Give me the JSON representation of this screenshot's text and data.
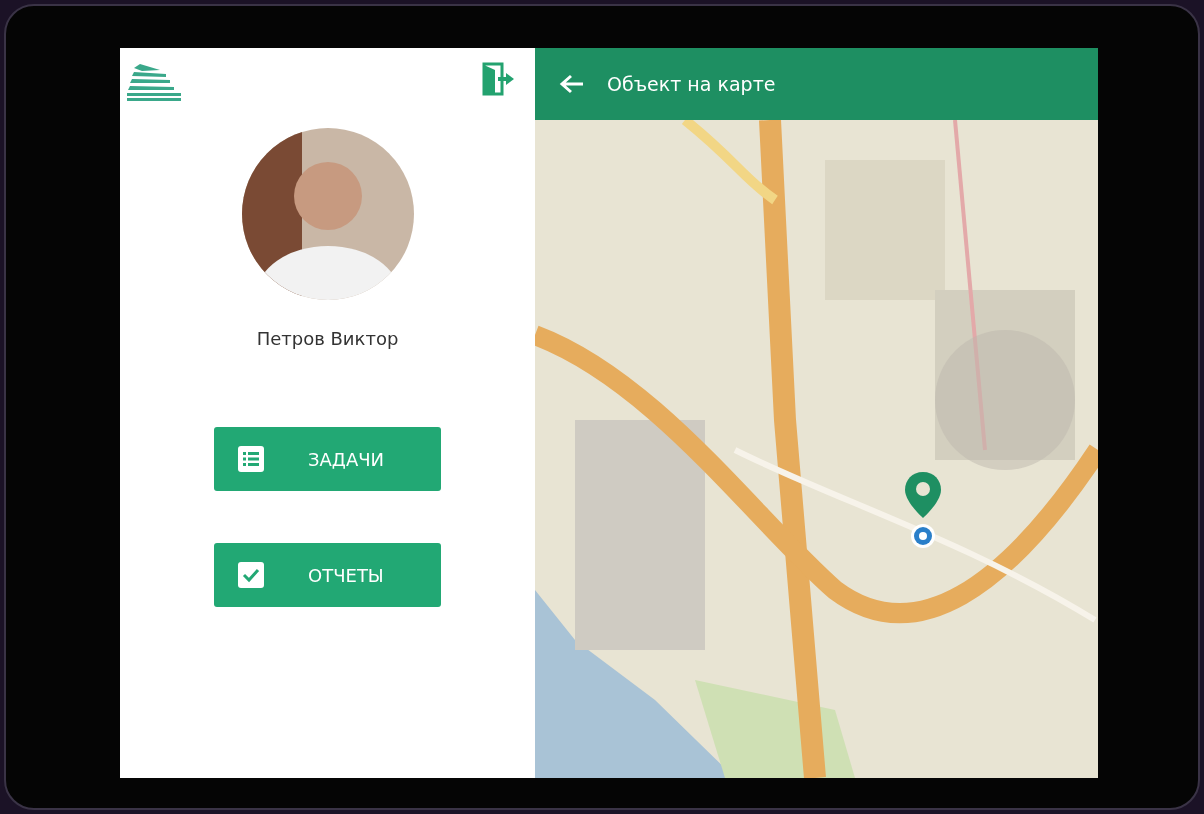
{
  "user": {
    "name": "Петров Виктор"
  },
  "menu": [
    {
      "kind": "tasks",
      "label": "ЗАДАЧИ"
    },
    {
      "kind": "reports",
      "label": "ОТЧЕТЫ"
    }
  ],
  "map_screen": {
    "title": "Объект на карте"
  }
}
